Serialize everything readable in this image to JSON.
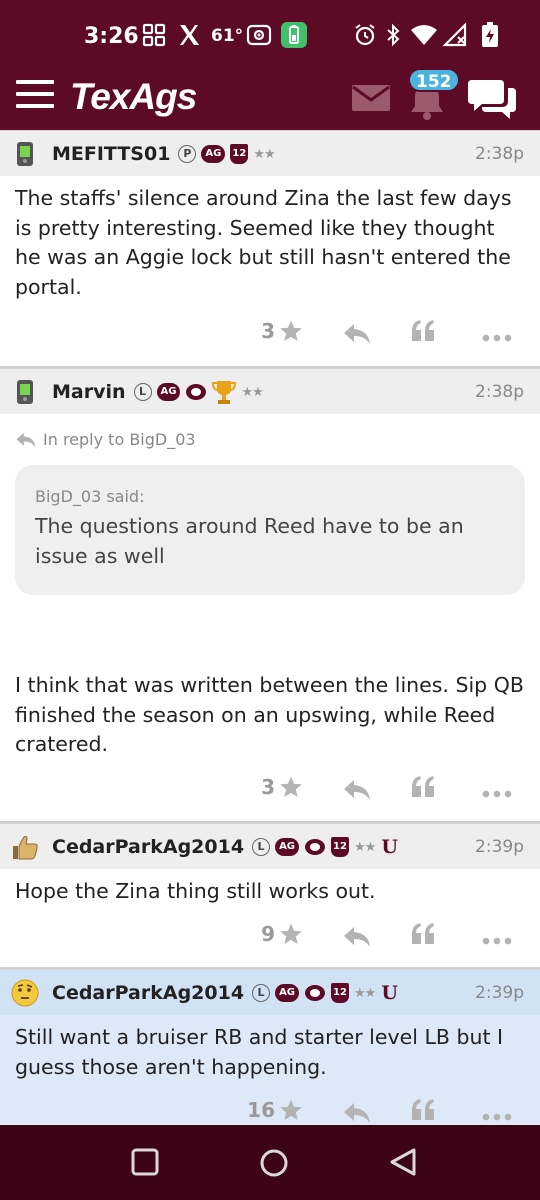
{
  "status_bar": {
    "time": "3:26",
    "temperature": "61°",
    "icons": [
      "grid-icon",
      "x-logo-icon",
      "radio-icon",
      "battery-saver-icon",
      "alarm-icon",
      "bluetooth-icon",
      "wifi-icon",
      "signal-icon",
      "battery-charging-icon"
    ]
  },
  "app_bar": {
    "logo": "TexAgs",
    "notification_count": "152",
    "colors": {
      "maroon": "#5c0a26",
      "badge_blue": "#4bb4de"
    }
  },
  "posts": [
    {
      "username": "MEFITTS01",
      "avatar": "phone-avatar-icon",
      "badges": [
        "P",
        "AG",
        "12",
        "★★"
      ],
      "time": "2:38p",
      "body": "The staffs' silence around Zina the last few days is pretty interesting. Seemed like they thought he was an Aggie lock but still hasn't entered the portal.",
      "likes": "3"
    },
    {
      "username": "Marvin",
      "avatar": "phone-avatar-icon",
      "badges": [
        "L",
        "AG",
        "trophy",
        "★★"
      ],
      "time": "2:38p",
      "reply_to": "In reply to BigD_03",
      "quote_author": "BigD_03 said:",
      "quote_text": "The questions around Reed have to be an issue as well",
      "body": "I think that was written between the lines. Sip QB finished the season on an upswing, while Reed cratered.",
      "likes": "3"
    },
    {
      "username": "CedarParkAg2014",
      "avatar": "thumbs-up-avatar-icon",
      "badges": [
        "L",
        "AG",
        "12",
        "★★",
        "U"
      ],
      "time": "2:39p",
      "body": "Hope the Zina thing still works out.",
      "likes": "9"
    },
    {
      "username": "CedarParkAg2014",
      "avatar": "thinking-face-avatar-icon",
      "badges": [
        "L",
        "AG",
        "12",
        "★★",
        "U"
      ],
      "time": "2:39p",
      "body": "Still want a bruiser RB and starter level LB but I guess those aren't happening.",
      "likes": "16"
    }
  ]
}
